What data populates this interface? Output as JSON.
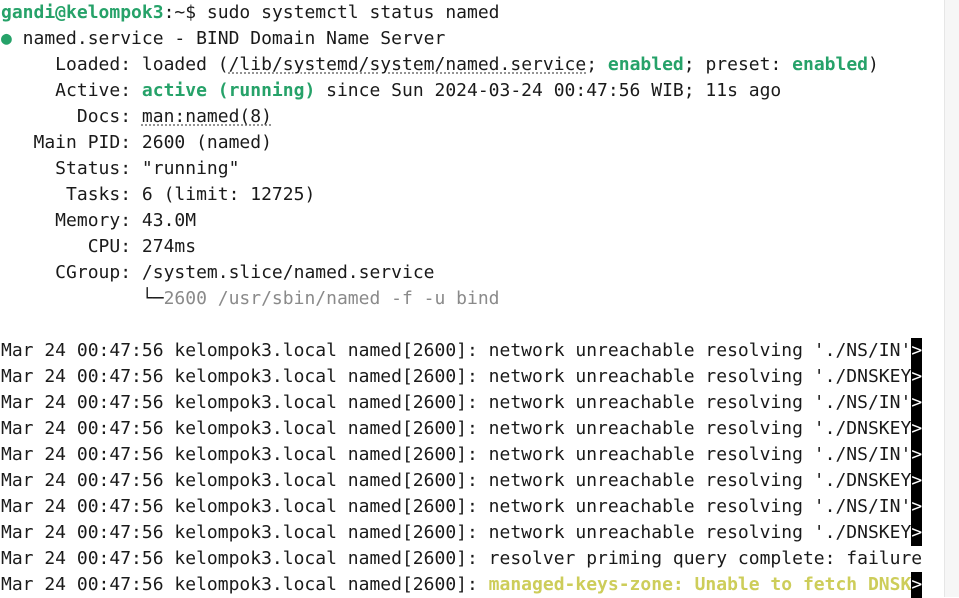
{
  "prompt": {
    "user_host": "gandi@kelompok3",
    "path": ":~$ ",
    "command": "sudo systemctl status named"
  },
  "unit": {
    "bullet": "●",
    "header": " named.service - BIND Domain Name Server"
  },
  "status": {
    "loaded_label": "     Loaded: ",
    "loaded_pre": "loaded (",
    "loaded_path": "/lib/systemd/system/named.service",
    "loaded_sep1": "; ",
    "loaded_enabled": "enabled",
    "loaded_sep2": "; preset: ",
    "loaded_preset": "enabled",
    "loaded_close": ")",
    "active_label": "     Active: ",
    "active_state": "active (running)",
    "active_since": " since Sun 2024-03-24 00:47:56 WIB; 11s ago",
    "docs_label": "       Docs: ",
    "docs_value": "man:named(8)",
    "pid_label": "   Main PID: ",
    "pid_value": "2600 (named)",
    "status_label": "     Status: ",
    "status_value": "\"running\"",
    "tasks_label": "      Tasks: ",
    "tasks_value": "6 (limit: 12725)",
    "memory_label": "     Memory: ",
    "memory_value": "43.0M",
    "cpu_label": "        CPU: ",
    "cpu_value": "274ms",
    "cgroup_label": "     CGroup: ",
    "cgroup_value": "/system.slice/named.service",
    "cgroup_tree": "             └─",
    "cgroup_proc": "2600 /usr/sbin/named -f -u bind"
  },
  "log": {
    "prefix": "Mar 24 00:47:56 kelompok3.local named[2600]: ",
    "lines": [
      "network unreachable resolving './NS/IN'",
      "network unreachable resolving './DNSKEY",
      "network unreachable resolving './NS/IN'",
      "network unreachable resolving './DNSKEY",
      "network unreachable resolving './NS/IN'",
      "network unreachable resolving './DNSKEY",
      "network unreachable resolving './NS/IN'",
      "network unreachable resolving './DNSKEY",
      "resolver priming query complete: failure",
      "managed-keys-zone: Unable to fetch DNSK"
    ],
    "trunc_marker": ">"
  }
}
